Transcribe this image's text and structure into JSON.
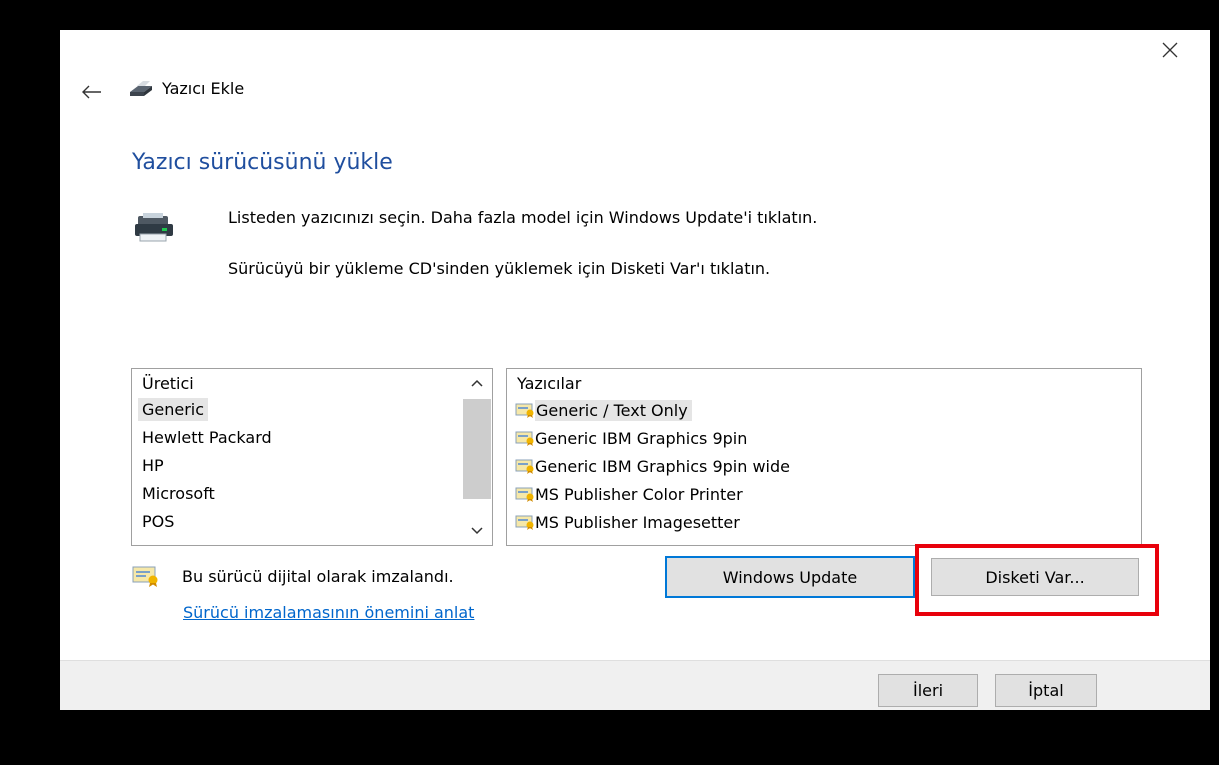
{
  "window": {
    "title": "Yazıcı Ekle"
  },
  "page": {
    "heading": "Yazıcı sürücüsünü yükle",
    "instruction_1": "Listeden yazıcınızı seçin. Daha fazla model için Windows Update'i tıklatın.",
    "instruction_2": "Sürücüyü bir yükleme CD'sinden yüklemek için Disketi Var'ı tıklatın."
  },
  "manufacturers": {
    "header": "Üretici",
    "items": [
      "Generic",
      "Hewlett Packard",
      "HP",
      "Microsoft",
      "POS"
    ],
    "selected": "Generic"
  },
  "printers": {
    "header": "Yazıcılar",
    "items": [
      "Generic / Text Only",
      "Generic IBM Graphics 9pin",
      "Generic IBM Graphics 9pin wide",
      "MS Publisher Color Printer",
      "MS Publisher Imagesetter"
    ],
    "selected": "Generic / Text Only"
  },
  "signature": {
    "text": "Bu sürücü dijital olarak imzalandı.",
    "link": "Sürücü imzalamasının önemini anlat"
  },
  "buttons": {
    "windows_update": "Windows Update",
    "have_disk": "Disketi Var...",
    "next": "İleri",
    "cancel": "İptal"
  },
  "colors": {
    "heading": "#1f4e9e",
    "link": "#0066cc",
    "focus_border": "#0078d7",
    "highlight": "#e8000b"
  }
}
